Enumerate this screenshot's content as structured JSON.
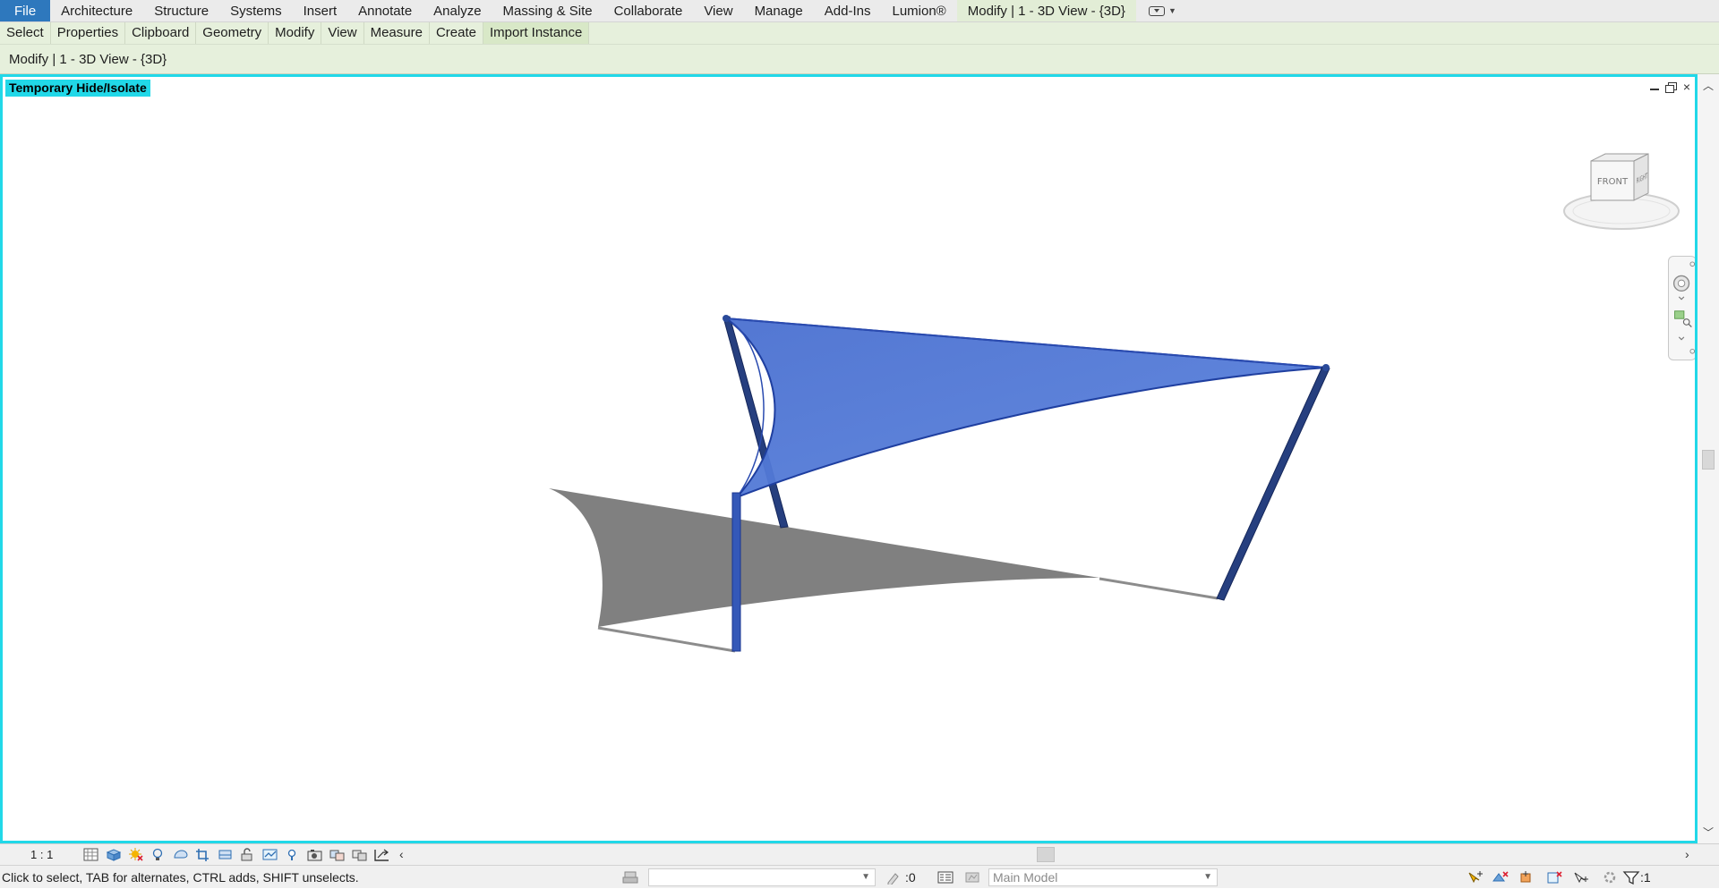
{
  "ribbon": {
    "tabs": [
      {
        "label": "File"
      },
      {
        "label": "Architecture"
      },
      {
        "label": "Structure"
      },
      {
        "label": "Systems"
      },
      {
        "label": "Insert"
      },
      {
        "label": "Annotate"
      },
      {
        "label": "Analyze"
      },
      {
        "label": "Massing & Site"
      },
      {
        "label": "Collaborate"
      },
      {
        "label": "View"
      },
      {
        "label": "Manage"
      },
      {
        "label": "Add-Ins"
      },
      {
        "label": "Lumion®"
      },
      {
        "label": "Modify | 1 - 3D View - {3D}"
      }
    ],
    "panels": [
      {
        "label": "Select"
      },
      {
        "label": "Properties"
      },
      {
        "label": "Clipboard"
      },
      {
        "label": "Geometry"
      },
      {
        "label": "Modify"
      },
      {
        "label": "View"
      },
      {
        "label": "Measure"
      },
      {
        "label": "Create"
      },
      {
        "label": "Import Instance"
      }
    ]
  },
  "options_bar": {
    "context_label": "Modify | 1 - 3D View - {3D}"
  },
  "viewport": {
    "mode_label": "Temporary Hide/Isolate",
    "viewcube": {
      "front": "FRONT",
      "right": "RIGHT"
    },
    "colors": {
      "border": "#21d8e8",
      "sail": "#4f77d4",
      "post": "#2a4a9a",
      "shadow": "#7f7f7f"
    }
  },
  "view_control_bar": {
    "scale": "1 : 1"
  },
  "status_bar": {
    "message": "Click to select, TAB for alternates, CTRL adds, SHIFT unselects.",
    "editable_count": ":0",
    "model_dropdown": "Main Model",
    "filter_count": ":1"
  }
}
